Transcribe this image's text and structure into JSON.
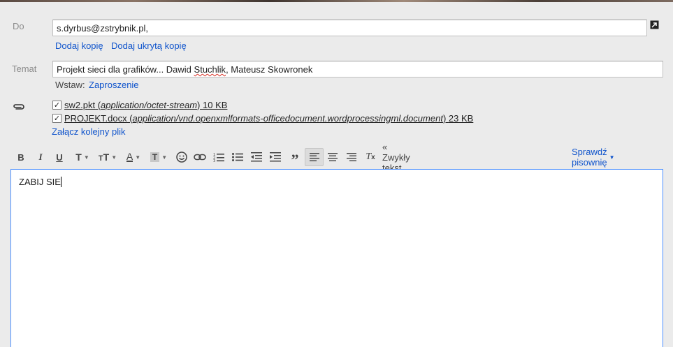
{
  "to": {
    "label": "Do",
    "value": "s.dyrbus@zstrybnik.pl,",
    "add_cc": "Dodaj kopię",
    "add_bcc": "Dodaj ukrytą kopię"
  },
  "subject": {
    "label": "Temat",
    "value_before": "Projekt sieci dla grafików... Dawid ",
    "value_misspelled": "Stuchlik",
    "value_after": ", Mateusz Skowronek"
  },
  "insert": {
    "label": "Wstaw:",
    "invitation": "Zaproszenie"
  },
  "attachments": [
    {
      "checked": true,
      "filename": "sw2.pkt",
      "mime": "application/octet-stream",
      "size": "10 KB"
    },
    {
      "checked": true,
      "filename": "PROJEKT.docx",
      "mime": "application/vnd.openxmlformats-officedocument.wordprocessingml.document",
      "size": "23 KB"
    }
  ],
  "attach_another": "Załącz kolejny plik",
  "toolbar": {
    "plain_text": "« Zwykły tekst",
    "spellcheck": "Sprawdź pisownię"
  },
  "body": {
    "text": "ZABIJ SIE"
  },
  "colors": {
    "link": "#1155cc",
    "editor_border": "#4d90fe",
    "label": "#8c8c8c"
  }
}
